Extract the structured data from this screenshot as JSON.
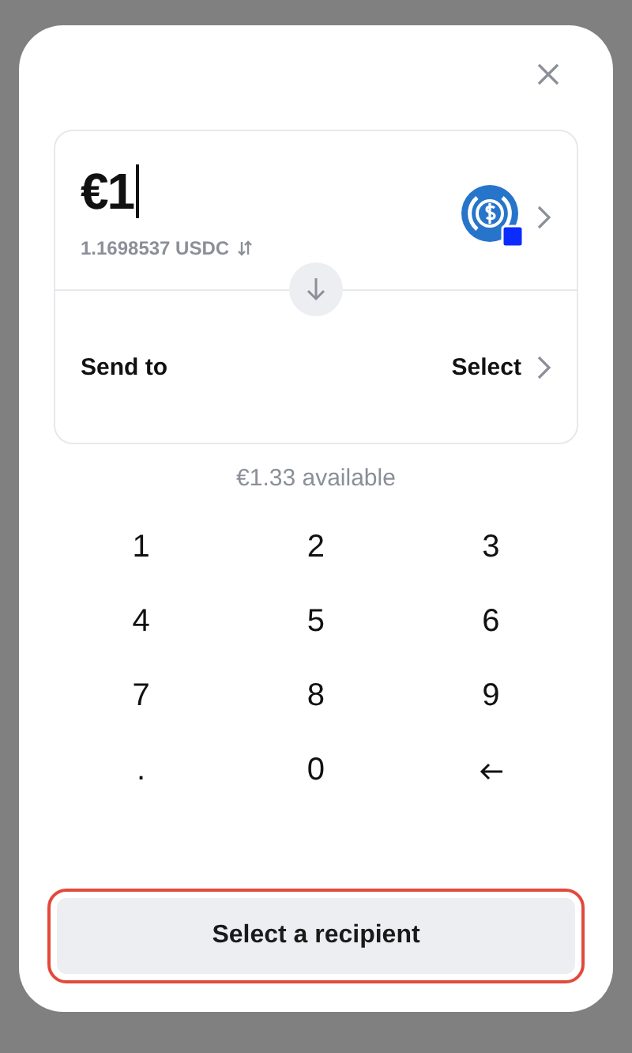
{
  "amount": {
    "value": "€1",
    "converted": "1.1698537 USDC"
  },
  "send_to": {
    "label": "Send to",
    "value": "Select"
  },
  "available": "€1.33 available",
  "keypad": [
    {
      "kind": "key",
      "label": "1"
    },
    {
      "kind": "key",
      "label": "2"
    },
    {
      "kind": "key",
      "label": "3"
    },
    {
      "kind": "key",
      "label": "4"
    },
    {
      "kind": "key",
      "label": "5"
    },
    {
      "kind": "key",
      "label": "6"
    },
    {
      "kind": "key",
      "label": "7"
    },
    {
      "kind": "key",
      "label": "8"
    },
    {
      "kind": "key",
      "label": "9"
    },
    {
      "kind": "key",
      "label": "."
    },
    {
      "kind": "key",
      "label": "0"
    },
    {
      "kind": "backspace"
    }
  ],
  "primary_button": {
    "label": "Select a recipient",
    "highlighted": true
  }
}
